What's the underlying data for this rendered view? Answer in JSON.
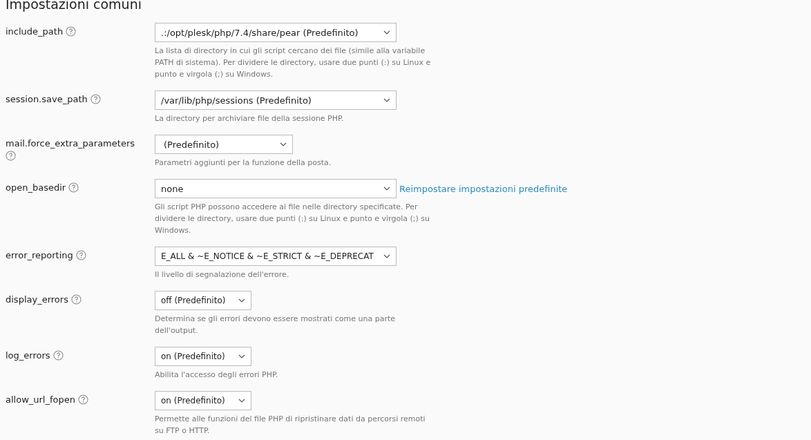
{
  "section_title": "Impostazioni comuni",
  "settings": [
    {
      "name": "include_path",
      "value": ".:/opt/plesk/php/7.4/share/pear (Predefinito)",
      "description": "La lista di directory in cui gli script cercano dei file (simile alla variabile PATH di sistema). Per dividere le directory, usare due punti (:) su Linux e punto e virgola (;) su Windows."
    },
    {
      "name": "session.save_path",
      "value": "/var/lib/php/sessions (Predefinito)",
      "description": "La directory per archiviare file della sessione PHP."
    },
    {
      "name": "mail.force_extra_parameters",
      "value": "(Predefinito)",
      "description": "Parametri aggiunti per la funzione della posta."
    },
    {
      "name": "open_basedir",
      "value": "none",
      "link": "Reimpostare impostazioni predefinite",
      "description": "Gli script PHP possono accedere ai file nelle directory specificate. Per dividere le directory, usare due punti (:) su Linux e punto e virgola (;) su Windows."
    },
    {
      "name": "error_reporting",
      "value": "E_ALL & ~E_NOTICE & ~E_STRICT & ~E_DEPRECAT",
      "description": "Il livello di segnalazione dell'errore."
    },
    {
      "name": "display_errors",
      "value": "off (Predefinito)",
      "description": "Determina se gli errori devono essere mostrati come una parte dell'output."
    },
    {
      "name": "log_errors",
      "value": "on (Predefinito)",
      "description": "Abilita l'accesso degli errori PHP."
    },
    {
      "name": "allow_url_fopen",
      "value": "on (Predefinito)",
      "description": "Permette alle funzioni del file PHP di ripristinare dati da percorsi remoti su FTP o HTTP."
    }
  ]
}
